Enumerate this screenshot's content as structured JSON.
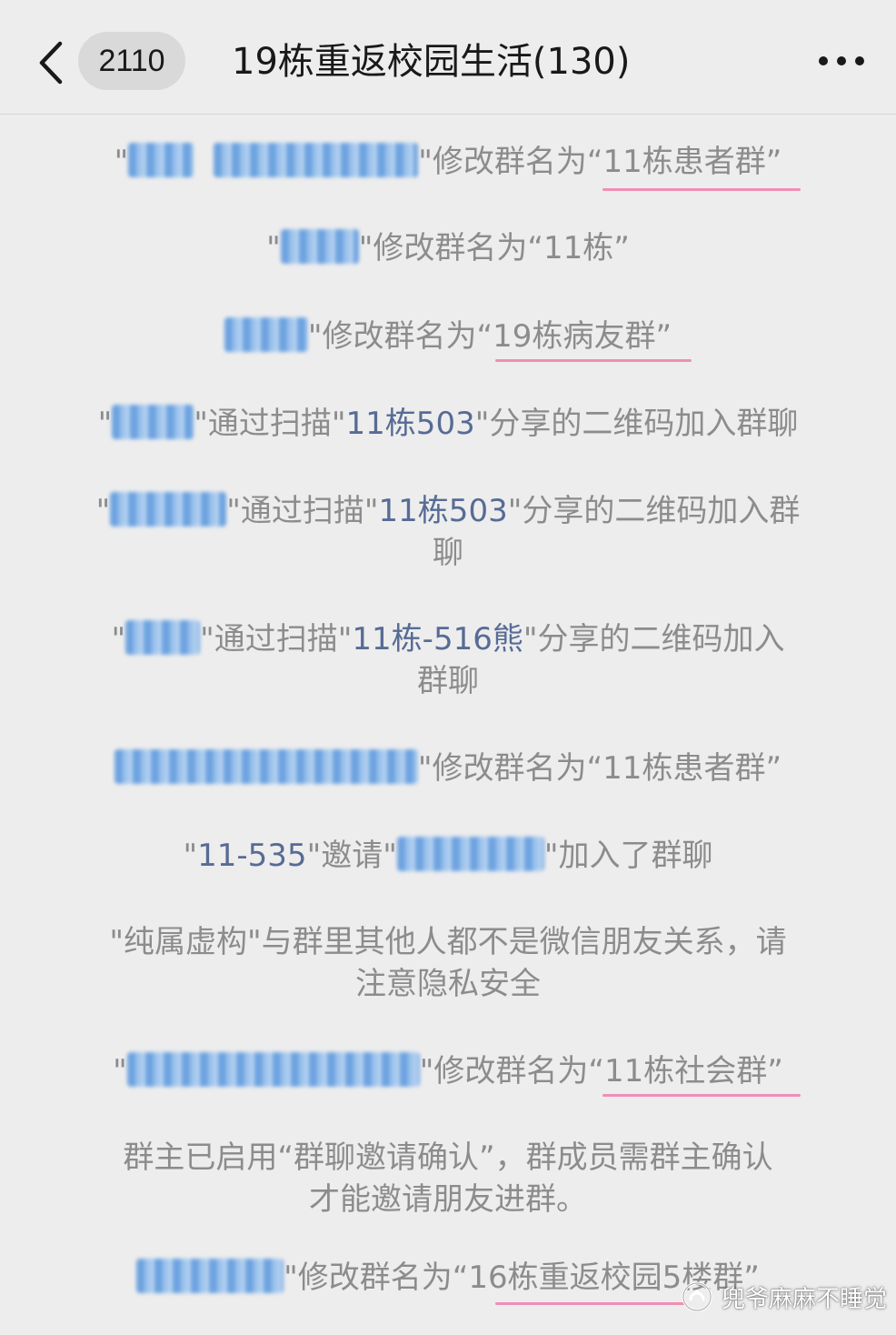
{
  "header": {
    "back_icon": "chevron-left-icon",
    "unread_count": "2110",
    "title": "19栋重返校园生活(130)",
    "more_icon": "ellipsis-icon"
  },
  "messages": [
    {
      "pre": "\"",
      "post": "\"修改群名为“11栋患者群”"
    },
    {
      "pre": "\"",
      "post": "\"修改群名为“11栋”"
    },
    {
      "pre": "",
      "post": "\"修改群名为“19栋病友群”"
    },
    {
      "pre": "\"",
      "mid": "\"通过扫描\"",
      "link": "11栋503",
      "post": "\"分享的二维码加入群聊"
    },
    {
      "pre": "\"",
      "mid": "\"通过扫描\"",
      "link": "11栋503",
      "post": "\"分享的二维码加入群",
      "line2": "聊"
    },
    {
      "pre": "\"",
      "mid": "\"通过扫描\"",
      "link": "11栋-516熊",
      "post": "\"分享的二维码加入",
      "line2": "群聊"
    },
    {
      "pre": "",
      "post": "\"修改群名为“11栋患者群”"
    },
    {
      "pre": "\"",
      "link": "11-535",
      "mid": "\"邀请\"",
      "post": "\"加入了群聊"
    },
    {
      "line1": "\"纯属虚构\"与群里其他人都不是微信朋友关系，请",
      "line2": "注意隐私安全"
    },
    {
      "pre": "\"",
      "post": "\"修改群名为“11栋社会群”"
    },
    {
      "line1": "群主已启用“群聊邀请确认”，群成员需群主确认",
      "line2": "才能邀请朋友进群。"
    },
    {
      "pre": "",
      "post": "\"修改群名为“16栋重返校园5楼群”"
    }
  ],
  "watermark": {
    "icon": "wechat-official-account-icon",
    "text": "兜爷麻麻不睡觉"
  },
  "colors": {
    "background": "#ededed",
    "system_text": "#8c8c8c",
    "link": "#576b95",
    "underline": "#ef8fb4",
    "redaction": "#6aa3e3"
  }
}
